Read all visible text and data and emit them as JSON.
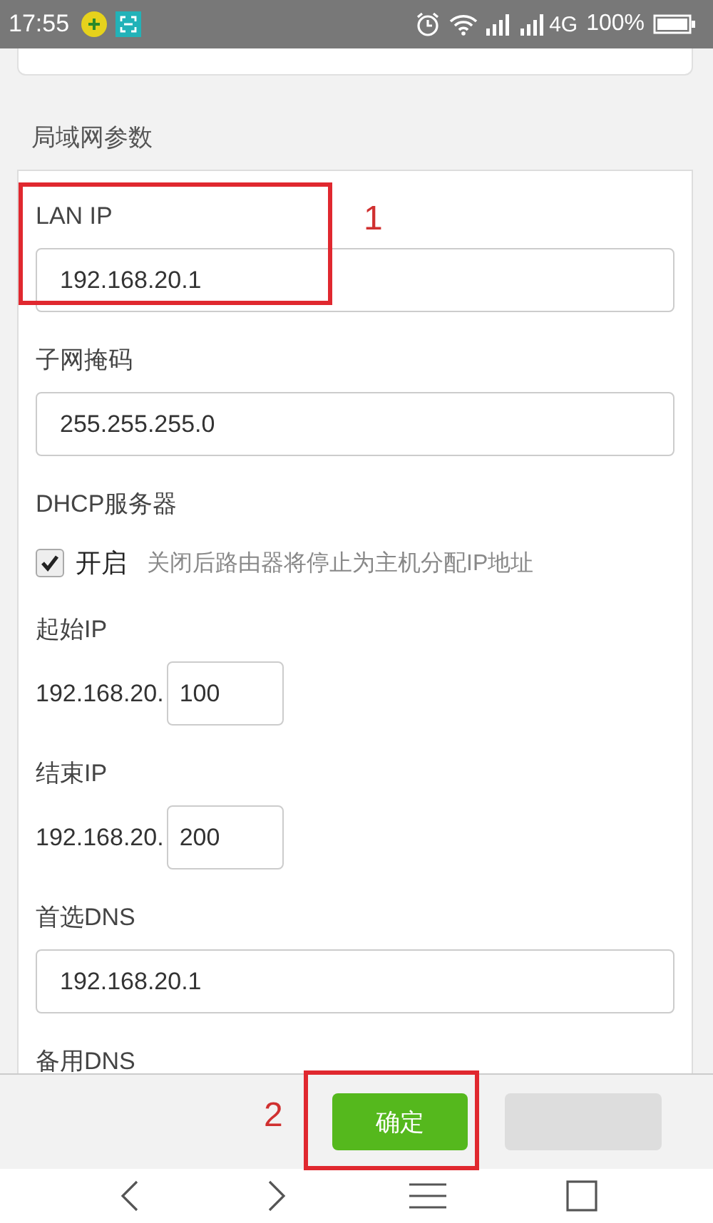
{
  "status_bar": {
    "time": "17:55",
    "network": "4G",
    "battery": "100%"
  },
  "section_title": "局域网参数",
  "fields": [
    {
      "kind": "text",
      "label": "LAN IP",
      "value": "192.168.20.1"
    },
    {
      "kind": "text",
      "label": "子网掩码",
      "value": "255.255.255.0"
    },
    {
      "kind": "checkbox",
      "label": "DHCP服务器",
      "option": "开启",
      "checked": true,
      "hint": "关闭后路由器将停止为主机分配IP地址"
    },
    {
      "kind": "range",
      "label": "起始IP",
      "prefix": "192.168.20.",
      "value": "100"
    },
    {
      "kind": "range",
      "label": "结束IP",
      "prefix": "192.168.20.",
      "value": "200"
    },
    {
      "kind": "text",
      "label": "首选DNS",
      "value": "192.168.20.1"
    },
    {
      "kind": "label",
      "label": "备用DNS"
    }
  ],
  "buttons": [
    {
      "kind": "primary",
      "label": "确定"
    },
    {
      "kind": "secondary"
    }
  ],
  "annotations": [
    "1",
    "2"
  ]
}
